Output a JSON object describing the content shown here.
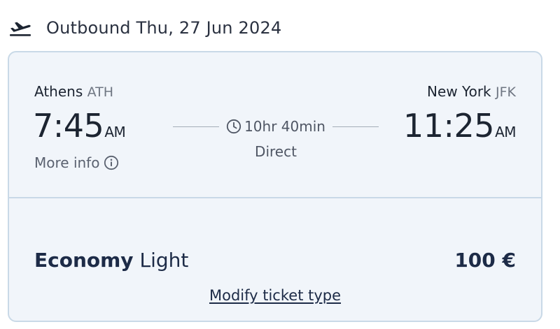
{
  "header": {
    "icon": "plane-takeoff-icon",
    "title": "Outbound Thu, 27 Jun 2024"
  },
  "flight": {
    "departure": {
      "city": "Athens",
      "code": "ATH",
      "time": "7:45",
      "ampm": "AM"
    },
    "arrival": {
      "city": "New York",
      "code": "JFK",
      "time": "11:25",
      "ampm": "AM"
    },
    "duration": "10hr 40min",
    "stops": "Direct",
    "more_info_label": "More info",
    "more_info_icon": "info-circle-icon",
    "duration_icon": "clock-icon"
  },
  "fare": {
    "cabin": "Economy",
    "type": "Light",
    "price": "100 €",
    "modify_label": "Modify ticket type"
  },
  "colors": {
    "card_background": "#f1f5fa",
    "card_border": "#c9d9e7",
    "fare_text": "#1d2b47"
  }
}
